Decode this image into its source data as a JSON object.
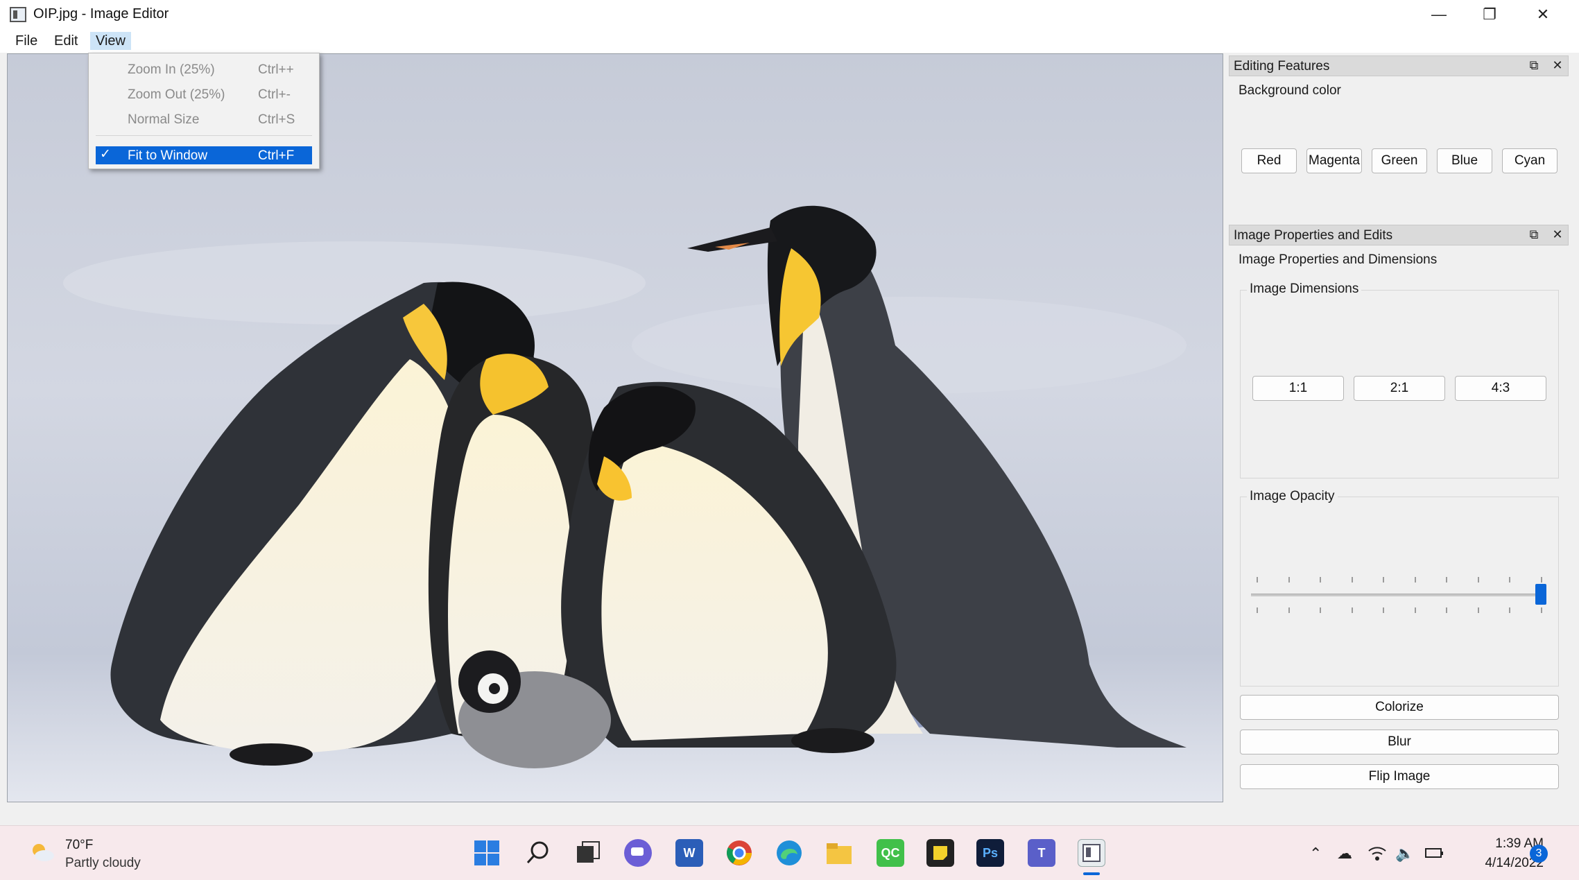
{
  "window": {
    "title": "OIP.jpg - Image Editor",
    "controls": {
      "minimize": "—",
      "restore": "❐",
      "close": "✕"
    }
  },
  "menubar": {
    "file": "File",
    "edit": "Edit",
    "view": "View"
  },
  "view_menu": {
    "items": [
      {
        "label": "Zoom In (25%)",
        "shortcut": "Ctrl++"
      },
      {
        "label": "Zoom Out (25%)",
        "shortcut": "Ctrl+-"
      },
      {
        "label": "Normal Size",
        "shortcut": "Ctrl+S"
      }
    ],
    "fit": {
      "label": "Fit to Window",
      "shortcut": "Ctrl+F",
      "checked": true,
      "check_glyph": "✓"
    }
  },
  "editing_features": {
    "title": "Editing Features",
    "section_label": "Background color",
    "buttons": [
      "Red",
      "Magenta",
      "Green",
      "Blue",
      "Cyan"
    ]
  },
  "image_properties": {
    "title": "Image Properties and Edits",
    "section_label": "Image Properties and Dimensions",
    "dimensions": {
      "title": "Image Dimensions",
      "buttons": [
        "1:1",
        "2:1",
        "4:3"
      ]
    },
    "opacity": {
      "title": "Image Opacity",
      "value": 100
    },
    "actions": [
      "Colorize",
      "Blur",
      "Flip Image"
    ]
  },
  "taskbar": {
    "weather": {
      "temp": "70°F",
      "desc": "Partly cloudy"
    },
    "clock": {
      "time": "1:39 AM",
      "date": "4/14/2022"
    },
    "notifications": "3",
    "apps": [
      "windows-start",
      "search",
      "task-view",
      "chat",
      "word",
      "chrome",
      "edge",
      "file-explorer",
      "qt-creator",
      "sticky-notes",
      "photoshop",
      "teams",
      "image-editor"
    ],
    "app_glyphs": {
      "word": "W",
      "photoshop": "Ps",
      "qt": "QC",
      "teams": "T"
    }
  },
  "colors": {
    "accent": "#0a66d8",
    "dock_title_bg": "#dadada",
    "taskbar_bg": "#f7e9ec"
  }
}
